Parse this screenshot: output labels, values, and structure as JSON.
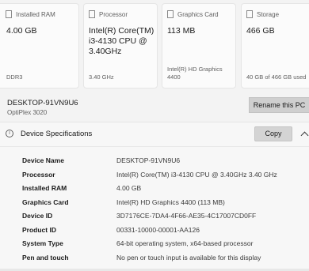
{
  "cards": [
    {
      "title": "Installed RAM",
      "value": "4.00 GB",
      "foot": "DDR3",
      "icon": "ram-icon"
    },
    {
      "title": "Processor",
      "value": "Intel(R) Core(TM) i3-4130 CPU @ 3.40GHz",
      "foot": "3.40 GHz",
      "icon": "processor-icon"
    },
    {
      "title": "Graphics Card",
      "value": "113 MB",
      "foot": "Intel(R) HD Graphics 4400",
      "icon": "graphics-card-icon"
    },
    {
      "title": "Storage",
      "value": "466 GB",
      "foot": "40 GB of 466 GB used",
      "icon": "storage-icon"
    }
  ],
  "device": {
    "name": "DESKTOP-91VN9U6",
    "model": "OptiPlex 3020",
    "rename_label": "Rename this PC"
  },
  "specs_header": {
    "title": "Device Specifications",
    "copy_label": "Copy",
    "info_glyph": "i"
  },
  "specs": [
    {
      "label": "Device Name",
      "value": "DESKTOP-91VN9U6"
    },
    {
      "label": "Processor",
      "value": "Intel(R) Core(TM) i3-4130 CPU @ 3.40GHz   3.40 GHz"
    },
    {
      "label": "Installed RAM",
      "value": "4.00 GB"
    },
    {
      "label": "Graphics Card",
      "value": "Intel(R) HD Graphics 4400 (113 MB)"
    },
    {
      "label": "Device ID",
      "value": "3D7176CE-7DA4-4F66-AE35-4C17007CD0FF"
    },
    {
      "label": "Product ID",
      "value": "00331-10000-00001-AA126"
    },
    {
      "label": "System Type",
      "value": "64-bit operating system, x64-based processor"
    },
    {
      "label": "Pen and touch",
      "value": "No pen or touch input is available for this display"
    }
  ]
}
